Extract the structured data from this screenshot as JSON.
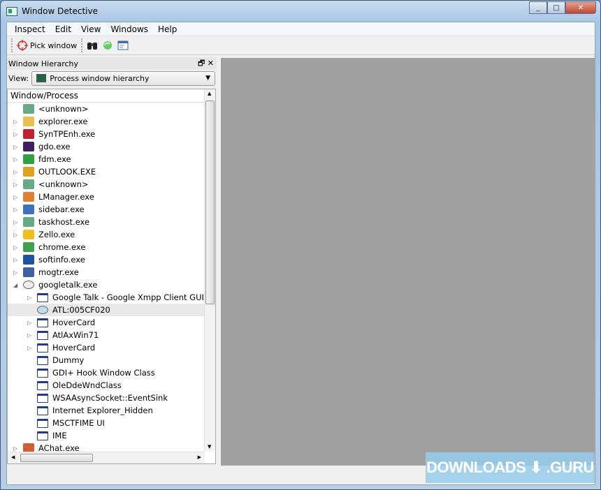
{
  "window": {
    "title": "Window Detective",
    "minimize": "_",
    "maximize": "□",
    "close": "✕"
  },
  "menu": [
    "Inspect",
    "Edit",
    "View",
    "Windows",
    "Help"
  ],
  "toolbar": {
    "pick_window": "Pick window"
  },
  "dock": {
    "title": "Window Hierarchy",
    "view_label": "View:",
    "view_value": "Process window hierarchy",
    "column_header": "Window/Process"
  },
  "tree": [
    {
      "label": "<unknown>",
      "level": 0,
      "expander": false,
      "icon": "window-app-icon",
      "color": "#6a8"
    },
    {
      "label": "explorer.exe",
      "level": 0,
      "expander": true,
      "icon": "folder-icon",
      "color": "#e8c050"
    },
    {
      "label": "SynTPEnh.exe",
      "level": 0,
      "expander": true,
      "icon": "synaptics-icon",
      "color": "#c02030"
    },
    {
      "label": "gdo.exe",
      "level": 0,
      "expander": true,
      "icon": "gdo-icon",
      "color": "#402060"
    },
    {
      "label": "fdm.exe",
      "level": 0,
      "expander": true,
      "icon": "fdm-icon",
      "color": "#30a040"
    },
    {
      "label": "OUTLOOK.EXE",
      "level": 0,
      "expander": true,
      "icon": "outlook-icon",
      "color": "#e0a020"
    },
    {
      "label": "<unknown>",
      "level": 0,
      "expander": true,
      "icon": "window-app-icon",
      "color": "#6a8"
    },
    {
      "label": "LManager.exe",
      "level": 0,
      "expander": true,
      "icon": "lmanager-icon",
      "color": "#e08030"
    },
    {
      "label": "sidebar.exe",
      "level": 0,
      "expander": true,
      "icon": "sidebar-icon",
      "color": "#4070c0"
    },
    {
      "label": "taskhost.exe",
      "level": 0,
      "expander": true,
      "icon": "window-app-icon",
      "color": "#6a8"
    },
    {
      "label": "Zello.exe",
      "level": 0,
      "expander": true,
      "icon": "zello-icon",
      "color": "#f0c020"
    },
    {
      "label": "chrome.exe",
      "level": 0,
      "expander": true,
      "icon": "chrome-icon",
      "color": "#40a050"
    },
    {
      "label": "softinfo.exe",
      "level": 0,
      "expander": true,
      "icon": "softinfo-icon",
      "color": "#2050a0"
    },
    {
      "label": "mogtr.exe",
      "level": 0,
      "expander": true,
      "icon": "mo-icon",
      "color": "#4060a0"
    },
    {
      "label": "googletalk.exe",
      "level": 0,
      "expander": "open",
      "icon": "speech-bubble-icon",
      "color": "#ccc"
    },
    {
      "label": "Google Talk - Google Xmpp Client GUI Wi...",
      "level": 1,
      "expander": true,
      "icon": "window-icon"
    },
    {
      "label": "ATL:005CF020",
      "level": 1,
      "expander": false,
      "icon": "speech-bubble-icon",
      "selected": true
    },
    {
      "label": "HoverCard",
      "level": 1,
      "expander": true,
      "icon": "window-icon"
    },
    {
      "label": "AtlAxWin71",
      "level": 1,
      "expander": true,
      "icon": "window-icon"
    },
    {
      "label": "HoverCard",
      "level": 1,
      "expander": true,
      "icon": "window-icon"
    },
    {
      "label": "Dummy",
      "level": 1,
      "expander": false,
      "icon": "window-icon"
    },
    {
      "label": "GDI+ Hook Window Class",
      "level": 1,
      "expander": false,
      "icon": "window-icon"
    },
    {
      "label": "OleDdeWndClass",
      "level": 1,
      "expander": false,
      "icon": "window-icon"
    },
    {
      "label": "WSAAsyncSocket::EventSink",
      "level": 1,
      "expander": false,
      "icon": "window-icon"
    },
    {
      "label": "Internet Explorer_Hidden",
      "level": 1,
      "expander": false,
      "icon": "window-icon"
    },
    {
      "label": "MSCTFIME UI",
      "level": 1,
      "expander": false,
      "icon": "window-icon"
    },
    {
      "label": "IME",
      "level": 1,
      "expander": false,
      "icon": "window-icon"
    },
    {
      "label": "AChat.exe",
      "level": 0,
      "expander": true,
      "icon": "achat-icon",
      "color": "#d06030"
    }
  ],
  "watermark": "DOWNLOADS ⬇ .GURU"
}
